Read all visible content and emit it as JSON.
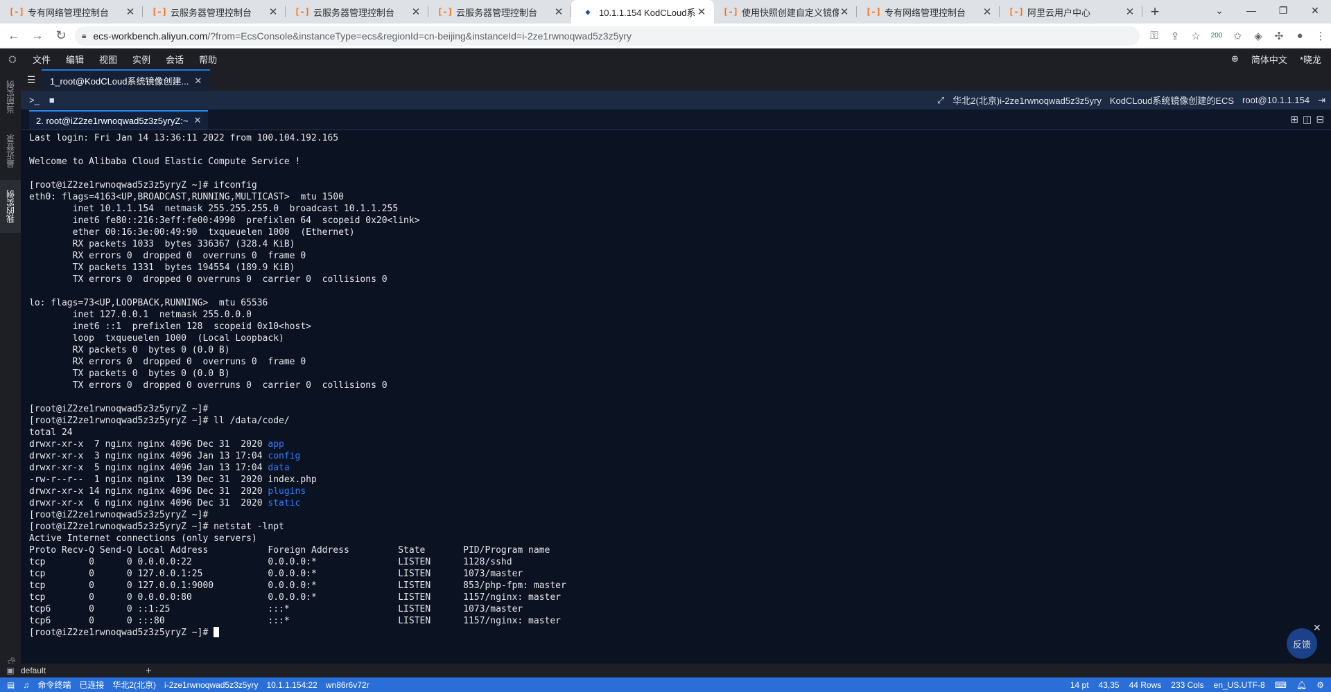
{
  "browser": {
    "tabs": [
      {
        "title": "专有网络管理控制台",
        "active": false
      },
      {
        "title": "云服务器管理控制台",
        "active": false
      },
      {
        "title": "云服务器管理控制台",
        "active": false
      },
      {
        "title": "云服务器管理控制台",
        "active": false
      },
      {
        "title": "10.1.1.154 KodCLoud系",
        "active": true
      },
      {
        "title": "使用快照创建自定义镜像",
        "active": false
      },
      {
        "title": "专有网络管理控制台",
        "active": false
      },
      {
        "title": "阿里云用户中心",
        "active": false
      }
    ],
    "url_host": "ecs-workbench.aliyun.com",
    "url_rest": "/?from=EcsConsole&instanceType=ecs&regionId=cn-beijing&instanceId=i-2ze1rwnoqwad5z3z5yry",
    "extension_count": "200"
  },
  "workbench": {
    "menu": [
      "文件",
      "编辑",
      "视图",
      "实例",
      "会话",
      "帮助"
    ],
    "language": "简体中文",
    "user": "*晓龙",
    "sidebar": [
      "当前实例",
      "最近登录",
      "我的实例"
    ],
    "session_tab": "1_root@KodCLoud系统镜像创建...",
    "instance_info": {
      "region": "华北2(北京)i-2ze1rwnoqwad5z3z5yry",
      "name": "KodCLoud系统镜像创建的ECS",
      "user": "root@10.1.1.154"
    },
    "terminal_tab": "2. root@iZ2ze1rwnoqwad5z3z5yryZ:~",
    "feedback": "反馈"
  },
  "terminal": {
    "lines": [
      "Last login: Fri Jan 14 13:36:11 2022 from 100.104.192.165",
      "",
      "Welcome to Alibaba Cloud Elastic Compute Service !",
      "",
      "[root@iZ2ze1rwnoqwad5z3z5yryZ ~]# ifconfig",
      "eth0: flags=4163<UP,BROADCAST,RUNNING,MULTICAST>  mtu 1500",
      "        inet 10.1.1.154  netmask 255.255.255.0  broadcast 10.1.1.255",
      "        inet6 fe80::216:3eff:fe00:4990  prefixlen 64  scopeid 0x20<link>",
      "        ether 00:16:3e:00:49:90  txqueuelen 1000  (Ethernet)",
      "        RX packets 1033  bytes 336367 (328.4 KiB)",
      "        RX errors 0  dropped 0  overruns 0  frame 0",
      "        TX packets 1331  bytes 194554 (189.9 KiB)",
      "        TX errors 0  dropped 0 overruns 0  carrier 0  collisions 0",
      "",
      "lo: flags=73<UP,LOOPBACK,RUNNING>  mtu 65536",
      "        inet 127.0.0.1  netmask 255.0.0.0",
      "        inet6 ::1  prefixlen 128  scopeid 0x10<host>",
      "        loop  txqueuelen 1000  (Local Loopback)",
      "        RX packets 0  bytes 0 (0.0 B)",
      "        RX errors 0  dropped 0  overruns 0  frame 0",
      "        TX packets 0  bytes 0 (0.0 B)",
      "        TX errors 0  dropped 0 overruns 0  carrier 0  collisions 0",
      "",
      "[root@iZ2ze1rwnoqwad5z3z5yryZ ~]#",
      "[root@iZ2ze1rwnoqwad5z3z5yryZ ~]# ll /data/code/",
      "total 24"
    ],
    "listing": [
      {
        "prefix": "drwxr-xr-x  7 nginx nginx 4096 Dec 31  2020 ",
        "name": "app",
        "dir": true
      },
      {
        "prefix": "drwxr-xr-x  3 nginx nginx 4096 Jan 13 17:04 ",
        "name": "config",
        "dir": true
      },
      {
        "prefix": "drwxr-xr-x  5 nginx nginx 4096 Jan 13 17:04 ",
        "name": "data",
        "dir": true
      },
      {
        "prefix": "-rw-r--r--  1 nginx nginx  139 Dec 31  2020 ",
        "name": "index.php",
        "dir": false
      },
      {
        "prefix": "drwxr-xr-x 14 nginx nginx 4096 Dec 31  2020 ",
        "name": "plugins",
        "dir": true
      },
      {
        "prefix": "drwxr-xr-x  6 nginx nginx 4096 Dec 31  2020 ",
        "name": "static",
        "dir": true
      }
    ],
    "lines_after": [
      "[root@iZ2ze1rwnoqwad5z3z5yryZ ~]#",
      "[root@iZ2ze1rwnoqwad5z3z5yryZ ~]# netstat -lnpt",
      "Active Internet connections (only servers)",
      "Proto Recv-Q Send-Q Local Address           Foreign Address         State       PID/Program name",
      "tcp        0      0 0.0.0.0:22              0.0.0.0:*               LISTEN      1128/sshd",
      "tcp        0      0 127.0.0.1:25            0.0.0.0:*               LISTEN      1073/master",
      "tcp        0      0 127.0.0.1:9000          0.0.0.0:*               LISTEN      853/php-fpm: master",
      "tcp        0      0 0.0.0.0:80              0.0.0.0:*               LISTEN      1157/nginx: master",
      "tcp6       0      0 ::1:25                  :::*                    LISTEN      1073/master",
      "tcp6       0      0 :::80                   :::*                    LISTEN      1157/nginx: master"
    ],
    "prompt": "[root@iZ2ze1rwnoqwad5z3z5yryZ ~]# "
  },
  "bottom": {
    "panel_tab": "default",
    "status_left": [
      "命令终端",
      "已连接",
      "华北2(北京)",
      "i-2ze1rwnoqwad5z3z5yry",
      "10.1.1.154:22",
      "wn86r6v72r"
    ],
    "status_right": [
      "14 pt",
      "43,35",
      "44 Rows",
      "233 Cols",
      "en_US.UTF-8"
    ]
  }
}
